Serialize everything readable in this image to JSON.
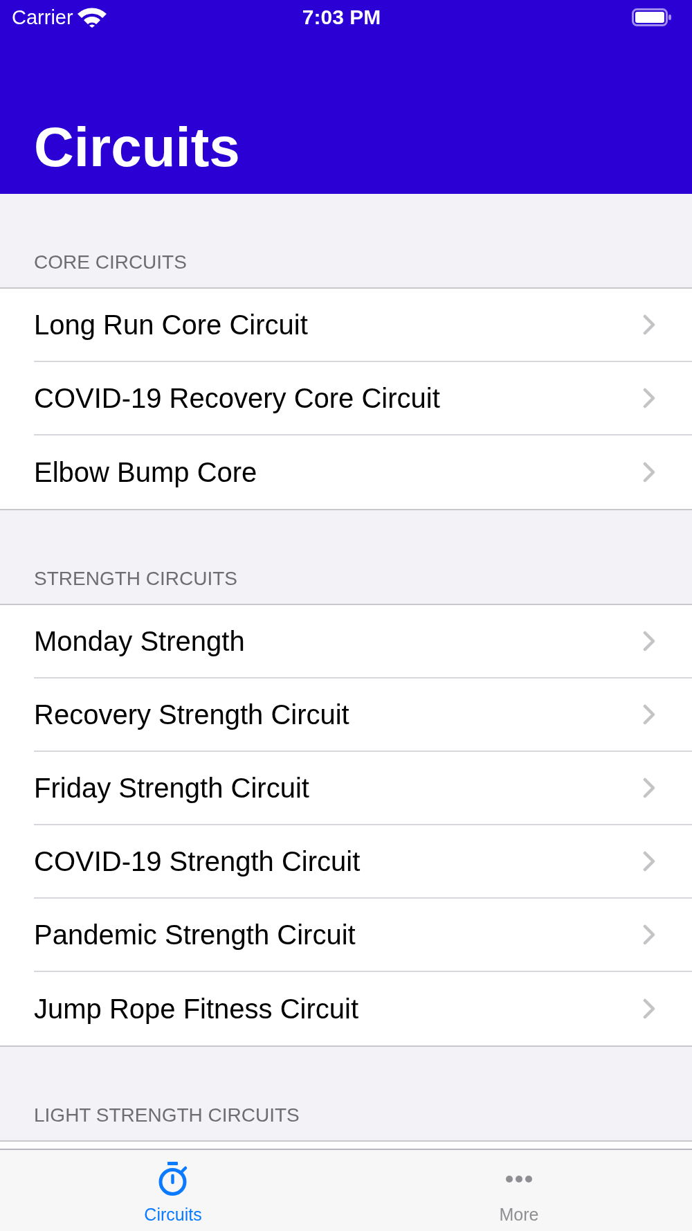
{
  "status_bar": {
    "carrier": "Carrier",
    "time": "7:03 PM"
  },
  "nav_bar": {
    "title": "Circuits"
  },
  "sections": [
    {
      "header": "CORE CIRCUITS",
      "rows": [
        {
          "title": "Long Run Core Circuit"
        },
        {
          "title": "COVID-19 Recovery Core Circuit"
        },
        {
          "title": "Elbow Bump Core"
        }
      ]
    },
    {
      "header": "STRENGTH CIRCUITS",
      "rows": [
        {
          "title": "Monday Strength"
        },
        {
          "title": "Recovery Strength Circuit"
        },
        {
          "title": "Friday Strength Circuit"
        },
        {
          "title": "COVID-19 Strength Circuit"
        },
        {
          "title": "Pandemic Strength Circuit"
        },
        {
          "title": "Jump Rope Fitness Circuit"
        }
      ]
    },
    {
      "header": "LIGHT STRENGTH CIRCUITS"
    }
  ],
  "tab_bar": {
    "tabs": [
      {
        "label": "Circuits",
        "kind": "timer",
        "selected": true
      },
      {
        "label": "More",
        "kind": "more",
        "selected": false
      }
    ]
  }
}
